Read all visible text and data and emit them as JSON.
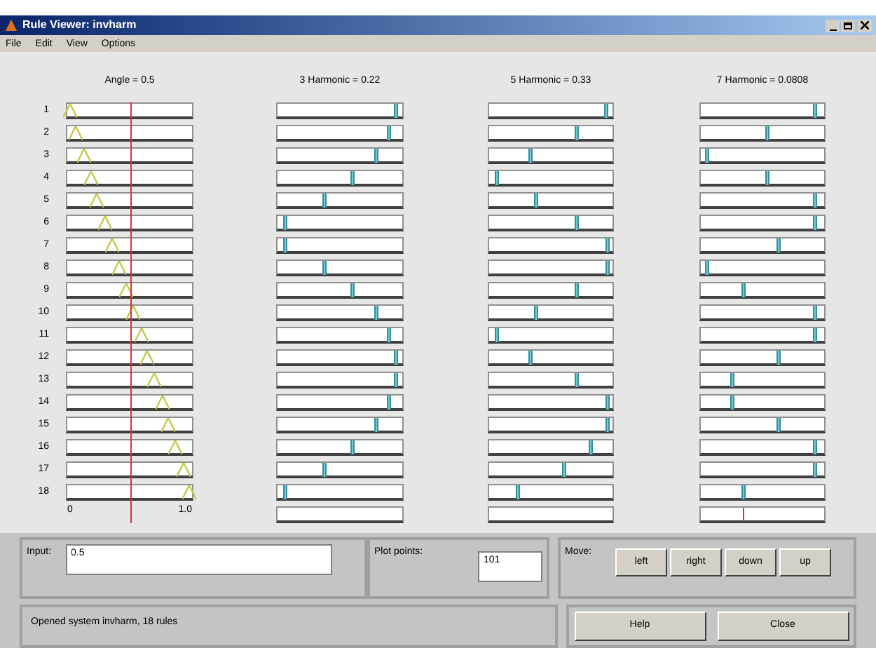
{
  "window": {
    "title": "Rule Viewer: invharm"
  },
  "menu": [
    "File",
    "Edit",
    "View",
    "Options"
  ],
  "input_variable": {
    "label": "Angle = 0.5",
    "level": 0.5,
    "axis_min": "0",
    "axis_max": "1.0",
    "rules": [
      {
        "number": "1",
        "level": 0.02
      },
      {
        "number": "2",
        "level": 0.07
      },
      {
        "number": "3",
        "level": 0.13
      },
      {
        "number": "4",
        "level": 0.19
      },
      {
        "number": "5",
        "level": 0.24
      },
      {
        "number": "6",
        "level": 0.3
      },
      {
        "number": "7",
        "level": 0.36
      },
      {
        "number": "8",
        "level": 0.42
      },
      {
        "number": "9",
        "level": 0.47
      },
      {
        "number": "10",
        "level": 0.53
      },
      {
        "number": "11",
        "level": 0.59
      },
      {
        "number": "12",
        "level": 0.64
      },
      {
        "number": "13",
        "level": 0.7
      },
      {
        "number": "14",
        "level": 0.76
      },
      {
        "number": "15",
        "level": 0.81
      },
      {
        "number": "16",
        "level": 0.87
      },
      {
        "number": "17",
        "level": 0.93
      },
      {
        "number": "18",
        "level": 0.98
      }
    ]
  },
  "output_variables": [
    {
      "label": "3 Harmonic = 0.22",
      "rules": [
        {
          "level": 0.94
        },
        {
          "level": 0.89
        },
        {
          "level": 0.79
        },
        {
          "level": 0.59
        },
        {
          "level": 0.37
        },
        {
          "level": 0.06
        },
        {
          "level": 0.06
        },
        {
          "level": 0.37
        },
        {
          "level": 0.59
        },
        {
          "level": 0.79
        },
        {
          "level": 0.89
        },
        {
          "level": 0.94
        },
        {
          "level": 0.94
        },
        {
          "level": 0.89
        },
        {
          "level": 0.79
        },
        {
          "level": 0.59
        },
        {
          "level": 0.37
        },
        {
          "level": 0.06
        }
      ]
    },
    {
      "label": "5 Harmonic = 0.33",
      "rules": [
        {
          "level": 0.94
        },
        {
          "level": 0.7
        },
        {
          "level": 0.33
        },
        {
          "level": 0.06
        },
        {
          "level": 0.38
        },
        {
          "level": 0.7
        },
        {
          "level": 0.95
        },
        {
          "level": 0.95
        },
        {
          "level": 0.7
        },
        {
          "level": 0.38
        },
        {
          "level": 0.06
        },
        {
          "level": 0.33
        },
        {
          "level": 0.7
        },
        {
          "level": 0.95
        },
        {
          "level": 0.95
        },
        {
          "level": 0.82
        },
        {
          "level": 0.6
        },
        {
          "level": 0.23
        }
      ]
    },
    {
      "label": "7 Harmonic = 0.0808",
      "aggregate": {
        "level": 0.34
      },
      "rules": [
        {
          "level": 0.92
        },
        {
          "level": 0.53
        },
        {
          "level": 0.05
        },
        {
          "level": 0.53
        },
        {
          "level": 0.92
        },
        {
          "level": 0.92
        },
        {
          "level": 0.62
        },
        {
          "level": 0.05
        },
        {
          "level": 0.34
        },
        {
          "level": 0.92
        },
        {
          "level": 0.92
        },
        {
          "level": 0.62
        },
        {
          "level": 0.25
        },
        {
          "level": 0.25
        },
        {
          "level": 0.62
        },
        {
          "level": 0.92
        },
        {
          "level": 0.92
        },
        {
          "level": 0.34
        }
      ]
    }
  ],
  "input_field": {
    "label": "Input:",
    "value": "0.5"
  },
  "plot_points": {
    "label": "Plot points:",
    "value": "101"
  },
  "move": {
    "label": "Move:",
    "buttons": [
      "left",
      "right",
      "down",
      "up"
    ]
  },
  "status": "Opened system invharm, 18 rules",
  "buttons": [
    "Help",
    "Close"
  ]
}
